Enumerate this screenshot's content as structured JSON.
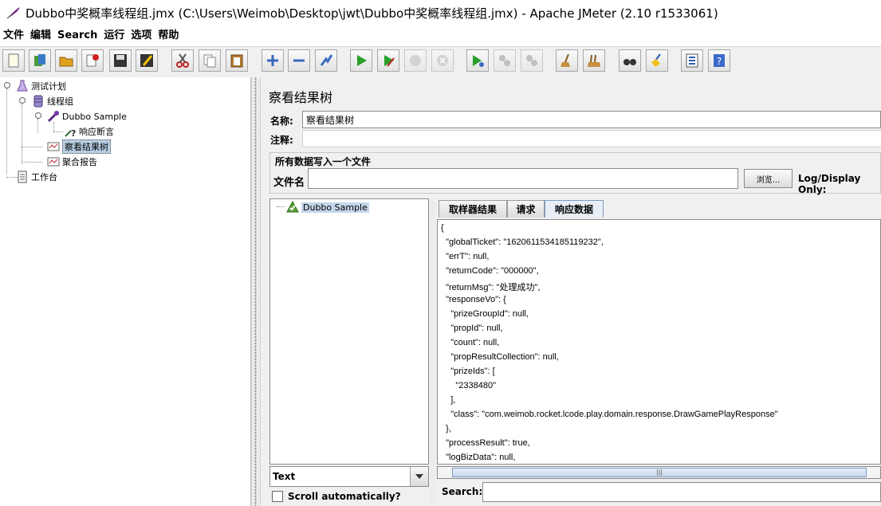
{
  "window": {
    "title": "Dubbo中奖概率线程组.jmx (C:\\Users\\Weimob\\Desktop\\jwt\\Dubbo中奖概率线程组.jmx) - Apache JMeter (2.10 r1533061)"
  },
  "menu": [
    "文件",
    "编辑",
    "Search",
    "运行",
    "选项",
    "帮助"
  ],
  "toolbar": [
    {
      "name": "new-icon"
    },
    {
      "name": "templates-icon"
    },
    {
      "name": "open-icon"
    },
    {
      "name": "close-icon"
    },
    {
      "name": "save-icon"
    },
    {
      "name": "save-as-icon"
    },
    {
      "name": "cut-icon"
    },
    {
      "name": "copy-icon"
    },
    {
      "name": "paste-icon"
    },
    {
      "name": "expand-icon"
    },
    {
      "name": "collapse-icon"
    },
    {
      "name": "toggle-icon"
    },
    {
      "name": "start-icon"
    },
    {
      "name": "start-no-pauses-icon"
    },
    {
      "name": "stop-icon"
    },
    {
      "name": "shutdown-icon"
    },
    {
      "name": "remote-start-icon"
    },
    {
      "name": "remote-stop-icon"
    },
    {
      "name": "remote-shutdown-icon"
    },
    {
      "name": "clear-icon"
    },
    {
      "name": "clear-all-icon"
    },
    {
      "name": "search-icon"
    },
    {
      "name": "reset-search-icon"
    },
    {
      "name": "function-helper-icon"
    },
    {
      "name": "help-icon"
    }
  ],
  "tree": {
    "test_plan": "测试计划",
    "thread_group": "线程组",
    "sampler": "Dubbo Sample",
    "assertion": "响应断言",
    "view_results_tree": "察看结果树",
    "aggregate_report": "聚合报告",
    "workbench": "工作台"
  },
  "panel": {
    "title": "察看结果树",
    "name_label": "名称:",
    "name_value": "察看结果树",
    "comment_label": "注释:",
    "file_group_title": "所有数据写入一个文件",
    "filename_label": "文件名",
    "browse_label": "浏览...",
    "log_display_label": "Log/Display Only:"
  },
  "results": {
    "sample_node": "Dubbo Sample",
    "renderer_value": "Text",
    "scroll_auto_label": "Scroll automatically?",
    "tabs": [
      "取样器结果",
      "请求",
      "响应数据"
    ],
    "active_tab": "响应数据",
    "search_label": "Search:",
    "response_lines": [
      "{",
      "  \"globalTicket\": \"1620611534185119232\",",
      "  \"errT\": null,",
      "  \"returnCode\": \"000000\",",
      "  \"returnMsg\": \"处理成功\",",
      "  \"responseVo\": {",
      "    \"prizeGroupId\": null,",
      "    \"propId\": null,",
      "    \"count\": null,",
      "    \"propResultCollection\": null,",
      "    \"prizeIds\": [",
      "      \"2338480\"",
      "    ],",
      "    \"class\": \"com.weimob.rocket.lcode.play.domain.response.DrawGamePlayResponse\"",
      "  },",
      "  \"processResult\": true,",
      "  \"logBizData\": null,"
    ]
  }
}
